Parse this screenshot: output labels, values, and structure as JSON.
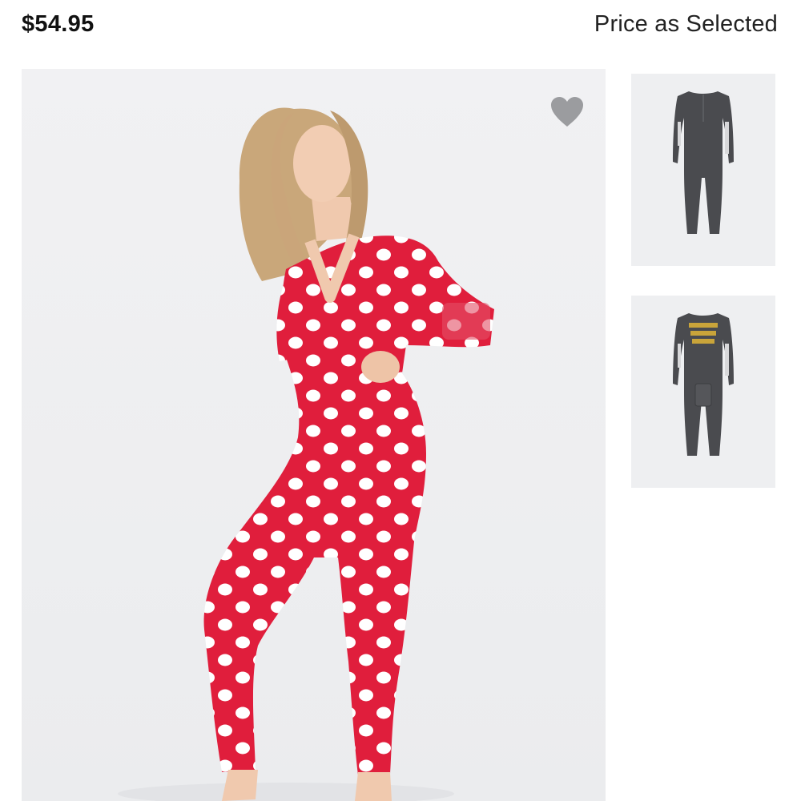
{
  "product": {
    "price": "$54.95",
    "price_note": "Price as Selected"
  },
  "gallery": {
    "main_image": "model-in-red-polka-dot-onesie",
    "thumbnails": [
      "charcoal-onesie-front",
      "charcoal-onesie-graphic-front"
    ],
    "favorite_icon": "heart-icon"
  },
  "colors": {
    "onesie_red": "#e01e3c",
    "dots": "#ffffff",
    "charcoal": "#4a4b4f",
    "heart": "#9b9c9f"
  }
}
